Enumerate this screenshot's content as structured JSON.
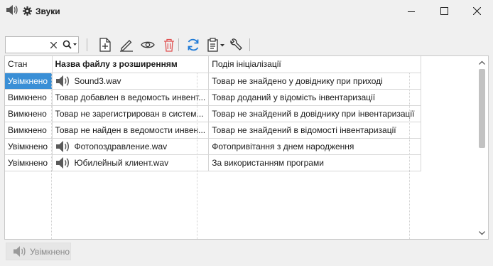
{
  "window": {
    "title": "Звуки",
    "icon": "speaker-icon",
    "settings_icon": "gear-icon"
  },
  "search": {
    "value": "",
    "placeholder": ""
  },
  "grid": {
    "headers": [
      "Стан",
      "Назва файлу з розширенням",
      "Подія ініціалізації"
    ],
    "rows": [
      {
        "status": "Увімкнено",
        "file": "Sound3.wav",
        "event": "Товар не знайдено у довіднику при приході",
        "icon": true,
        "selected": true
      },
      {
        "status": "Вимкнено",
        "file": "Товар добавлен в ведомость инвент...",
        "event": "Товар доданий у відомість інвентаризації",
        "icon": false,
        "selected": false
      },
      {
        "status": "Вимкнено",
        "file": "Товар не зарегистрирован в систем...",
        "event": "Товар не знайдений в довіднику при інвентаризації",
        "icon": false,
        "selected": false
      },
      {
        "status": "Вимкнено",
        "file": "Товар не найден в ведомости инвен...",
        "event": "Товар не знайдений в відомості інвентаризації",
        "icon": false,
        "selected": false
      },
      {
        "status": "Увімкнено",
        "file": "Фотопоздравление.wav",
        "event": "Фотопривітання з днем народження",
        "icon": true,
        "selected": false
      },
      {
        "status": "Увімкнено",
        "file": "Юбилейный клиент.wav",
        "event": "За використанням програми",
        "icon": true,
        "selected": false
      }
    ]
  },
  "footer": {
    "status_button": "Увімкнено"
  },
  "colors": {
    "selection": "#3a8fd6",
    "delete": "#e05050",
    "refresh": "#1f7ad6"
  }
}
